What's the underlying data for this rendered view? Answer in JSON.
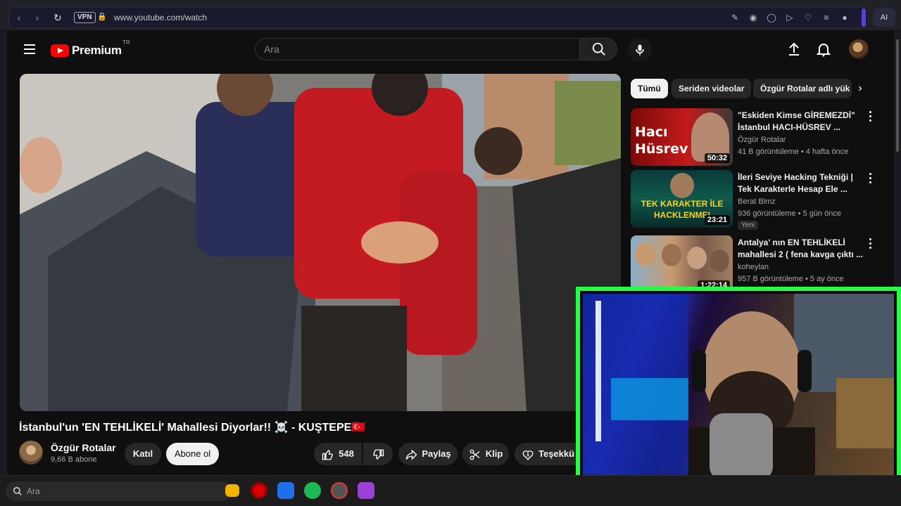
{
  "browser": {
    "url": "www.youtube.com/watch",
    "vpn_label": "VPN",
    "ai_label": "AI"
  },
  "header": {
    "logo_text": "Premium",
    "logo_region": "TR",
    "search_placeholder": "Ara"
  },
  "video": {
    "title": "İstanbul'un 'EN TEHLİKELİ' Mahallesi Diyorlar!! ☠️ - KUŞTEPE🇹🇷",
    "channel": "Özgür Rotalar",
    "subscribers": "9,66 B abone",
    "join_label": "Katıl",
    "subscribe_label": "Abone ol",
    "likes": "548",
    "share_label": "Paylaş",
    "clip_label": "Klip",
    "thanks_label": "Teşekkü"
  },
  "chips": [
    "Tümü",
    "Seriden videolar",
    "Özgür Rotalar adlı yük"
  ],
  "recommendations": [
    {
      "title": "\"Eskiden Kimse GİREMEZDİ\" İstanbul HACI-HÜSREV ...",
      "channel": "Özgür Rotalar",
      "meta": "41 B görüntüleme • 4 hafta önce",
      "duration": "50:32",
      "thumb_text": "Hacı Hüsrev",
      "badge": ""
    },
    {
      "title": "İleri Seviye Hacking Tekniği | Tek Karakterle Hesap Ele ...",
      "channel": "Berat Blmz",
      "meta": "936 görüntüleme • 5 gün önce",
      "duration": "23:21",
      "thumb_text": "TEK KARAKTER İLE HACKLENMEI",
      "badge": "Yeni"
    },
    {
      "title": "Antalya' nın EN TEHLİKELİ mahallesi 2 ( fena kavga çıktı ...",
      "channel": "koheylan",
      "meta": "957 B görüntüleme • 5 ay önce",
      "duration": "1:22:14",
      "thumb_text": "",
      "badge": ""
    }
  ],
  "taskbar": {
    "search_label": "Ara"
  },
  "colors": {
    "yt_red": "#ff0000",
    "cam_border": "#22ff44",
    "bg": "#0f0f0f"
  }
}
